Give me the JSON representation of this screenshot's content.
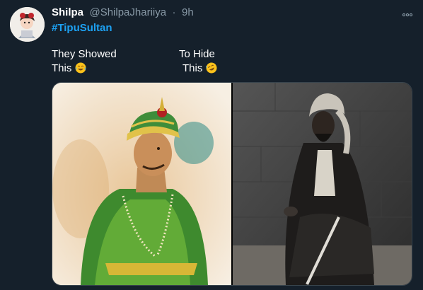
{
  "tweet": {
    "display_name": "Shilpa",
    "handle": "@ShilpaJhariiya",
    "separator": "·",
    "time": "9h",
    "hashtag": "#TipuSultan",
    "left_line1": "They Showed",
    "left_line2": "This",
    "right_line1": "To Hide",
    "right_line2": "This",
    "left_emoji": "face-with-tears-of-joy-icon",
    "right_emoji": "rolling-on-floor-laughing-icon"
  },
  "colors": {
    "background": "#15202b",
    "secondary_text": "#8899a6",
    "link": "#1da1f2",
    "border": "#38444d"
  }
}
